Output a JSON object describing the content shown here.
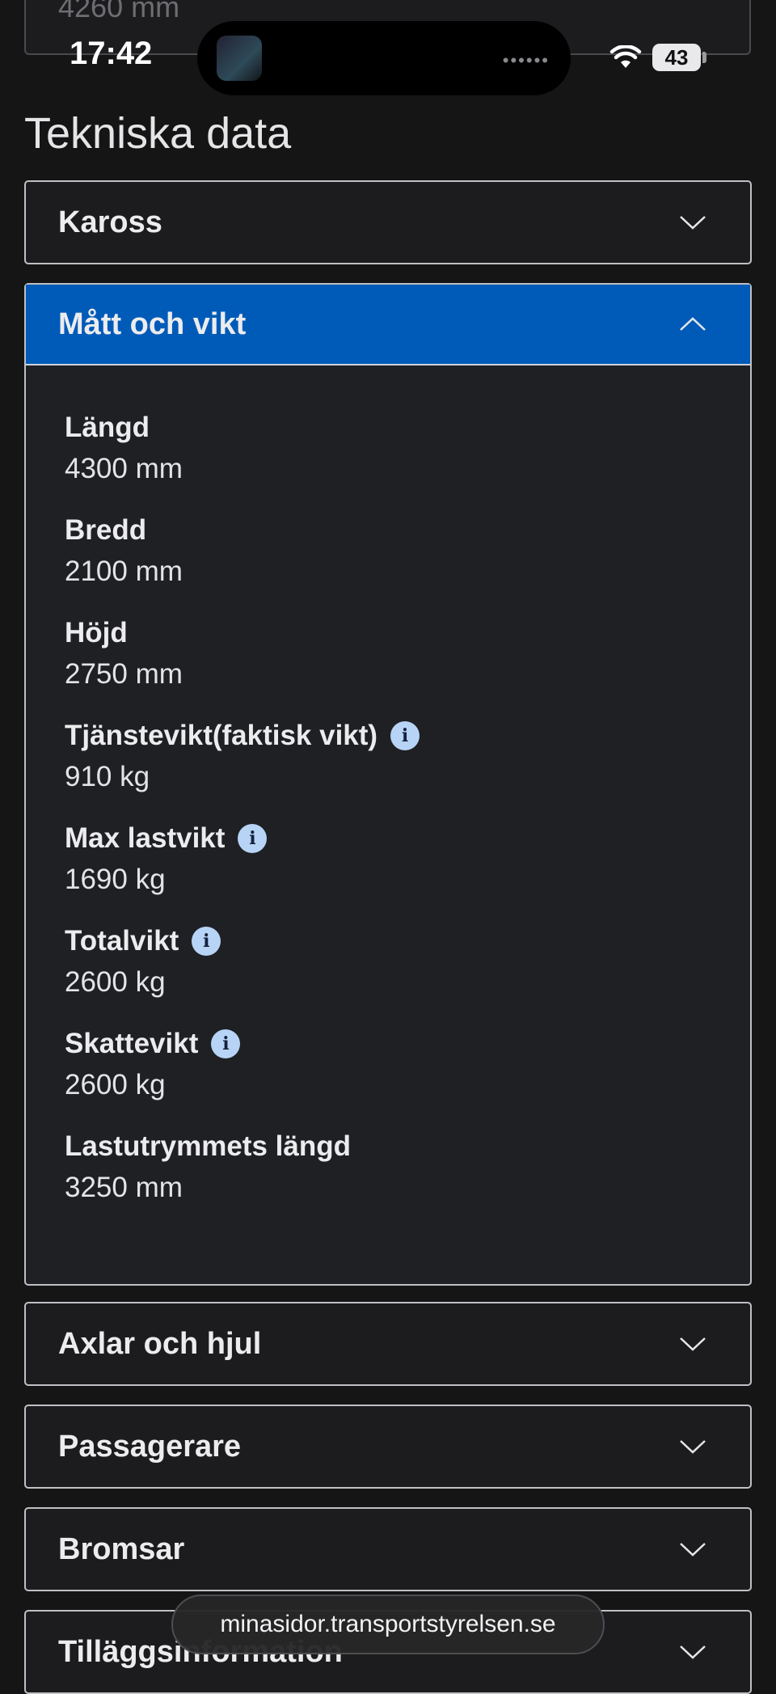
{
  "top_field": {
    "value": "4260 mm"
  },
  "status_bar": {
    "time": "17:42",
    "battery": "43",
    "island_dots": "••••••"
  },
  "section": {
    "title": "Tekniska data"
  },
  "accordions": [
    {
      "title": "Kaross",
      "expanded": false
    },
    {
      "title": "Mått och vikt",
      "expanded": true,
      "rows": [
        {
          "label": "Längd",
          "value": "4300 mm"
        },
        {
          "label": "Bredd",
          "value": "2100 mm"
        },
        {
          "label": "Höjd",
          "value": "2750 mm"
        },
        {
          "label": "Tjänstevikt(faktisk vikt)",
          "value": "910 kg",
          "info": true
        },
        {
          "label": "Max lastvikt",
          "value": "1690 kg",
          "info": true
        },
        {
          "label": "Totalvikt",
          "value": "2600 kg",
          "info": true
        },
        {
          "label": "Skattevikt",
          "value": "2600 kg",
          "info": true
        },
        {
          "label": "Lastutrymmets längd",
          "value": "3250 mm"
        }
      ]
    },
    {
      "title": "Axlar och hjul",
      "expanded": false
    },
    {
      "title": "Passagerare",
      "expanded": false
    },
    {
      "title": "Bromsar",
      "expanded": false
    },
    {
      "title": "Tilläggsinformation",
      "expanded": false
    }
  ],
  "browser": {
    "url": "minasidor.transportstyrelsen.se"
  },
  "info_icon_glyph": "i",
  "colors": {
    "expanded_header": "#005bb8",
    "info_icon": "#b7d4f6",
    "background": "#151516"
  }
}
